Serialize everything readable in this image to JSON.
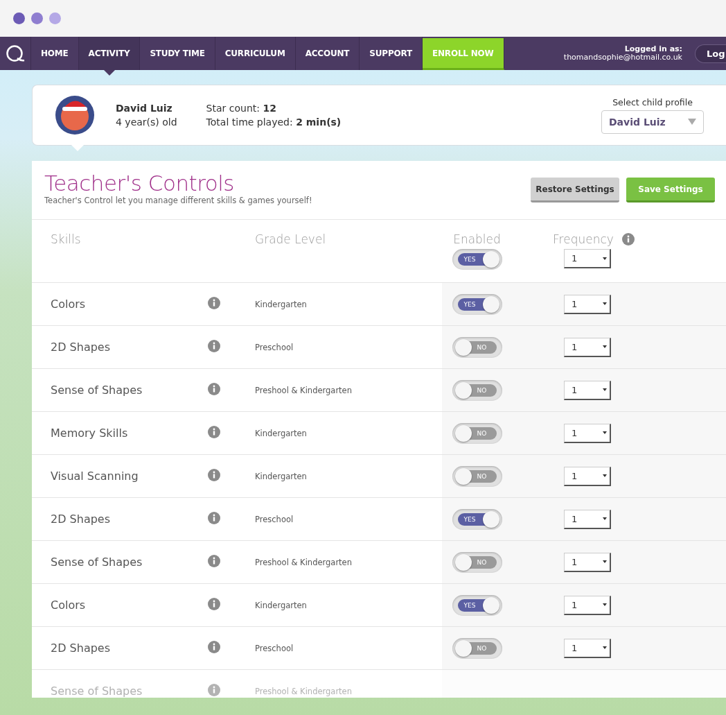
{
  "nav": {
    "items": [
      {
        "label": "HOME",
        "selected": false,
        "kind": "link"
      },
      {
        "label": "ACTIVITY",
        "selected": true,
        "kind": "link"
      },
      {
        "label": "STUDY TIME",
        "selected": false,
        "kind": "link"
      },
      {
        "label": "CURRICULUM",
        "selected": false,
        "kind": "link"
      },
      {
        "label": "ACCOUNT",
        "selected": false,
        "kind": "link"
      },
      {
        "label": "SUPPORT",
        "selected": false,
        "kind": "link"
      },
      {
        "label": "ENROLL NOW",
        "selected": false,
        "kind": "cta"
      }
    ],
    "logged_in_label": "Logged in as:",
    "email": "thomandsophie@hotmail.co.uk",
    "logout": "Log"
  },
  "profile": {
    "name": "David Luiz",
    "age": "4 year(s) old",
    "star_count": "Star count: **12**",
    "time_played": "Total time played: **2 min(s)**",
    "select_label": "Select child profile",
    "select_value": "David Luiz"
  },
  "panel": {
    "title": "Teacher's Controls",
    "subtitle": "Teacher's Control let you manage different skills & games yourself!",
    "buttons": [
      {
        "label": "Restore Settings",
        "kind": "secondary"
      },
      {
        "label": "Save Settings",
        "kind": "primary"
      }
    ],
    "columns": [
      "Skills",
      "Grade Level",
      "Enabled",
      "Frequency"
    ],
    "master": {
      "toggle_label": "YES",
      "on": true,
      "frequency": "1"
    },
    "rows": [
      {
        "skill": "Colors",
        "grade": "Kindergarten",
        "toggle_label": "YES",
        "on": true,
        "frequency": "1",
        "faded": false
      },
      {
        "skill": "2D Shapes",
        "grade": "Preschool",
        "toggle_label": "NO",
        "on": false,
        "frequency": "1",
        "faded": false
      },
      {
        "skill": "Sense of Shapes",
        "grade": "Preshool & Kindergarten",
        "toggle_label": "NO",
        "on": false,
        "frequency": "1",
        "faded": false
      },
      {
        "skill": "Memory Skills",
        "grade": "Kindergarten",
        "toggle_label": "NO",
        "on": false,
        "frequency": "1",
        "faded": false
      },
      {
        "skill": "Visual Scanning",
        "grade": "Kindergarten",
        "toggle_label": "NO",
        "on": false,
        "frequency": "1",
        "faded": false
      },
      {
        "skill": "2D Shapes",
        "grade": "Preschool",
        "toggle_label": "YES",
        "on": true,
        "frequency": "1",
        "faded": false
      },
      {
        "skill": "Sense of Shapes",
        "grade": "Preshool & Kindergarten",
        "toggle_label": "NO",
        "on": false,
        "frequency": "1",
        "faded": false
      },
      {
        "skill": "Colors",
        "grade": "Kindergarten",
        "toggle_label": "YES",
        "on": true,
        "frequency": "1",
        "faded": false
      },
      {
        "skill": "2D Shapes",
        "grade": "Preschool",
        "toggle_label": "NO",
        "on": false,
        "frequency": "1",
        "faded": false
      },
      {
        "skill": "Sense of Shapes",
        "grade": "Preshool & Kindergarten",
        "faded": true
      }
    ]
  }
}
